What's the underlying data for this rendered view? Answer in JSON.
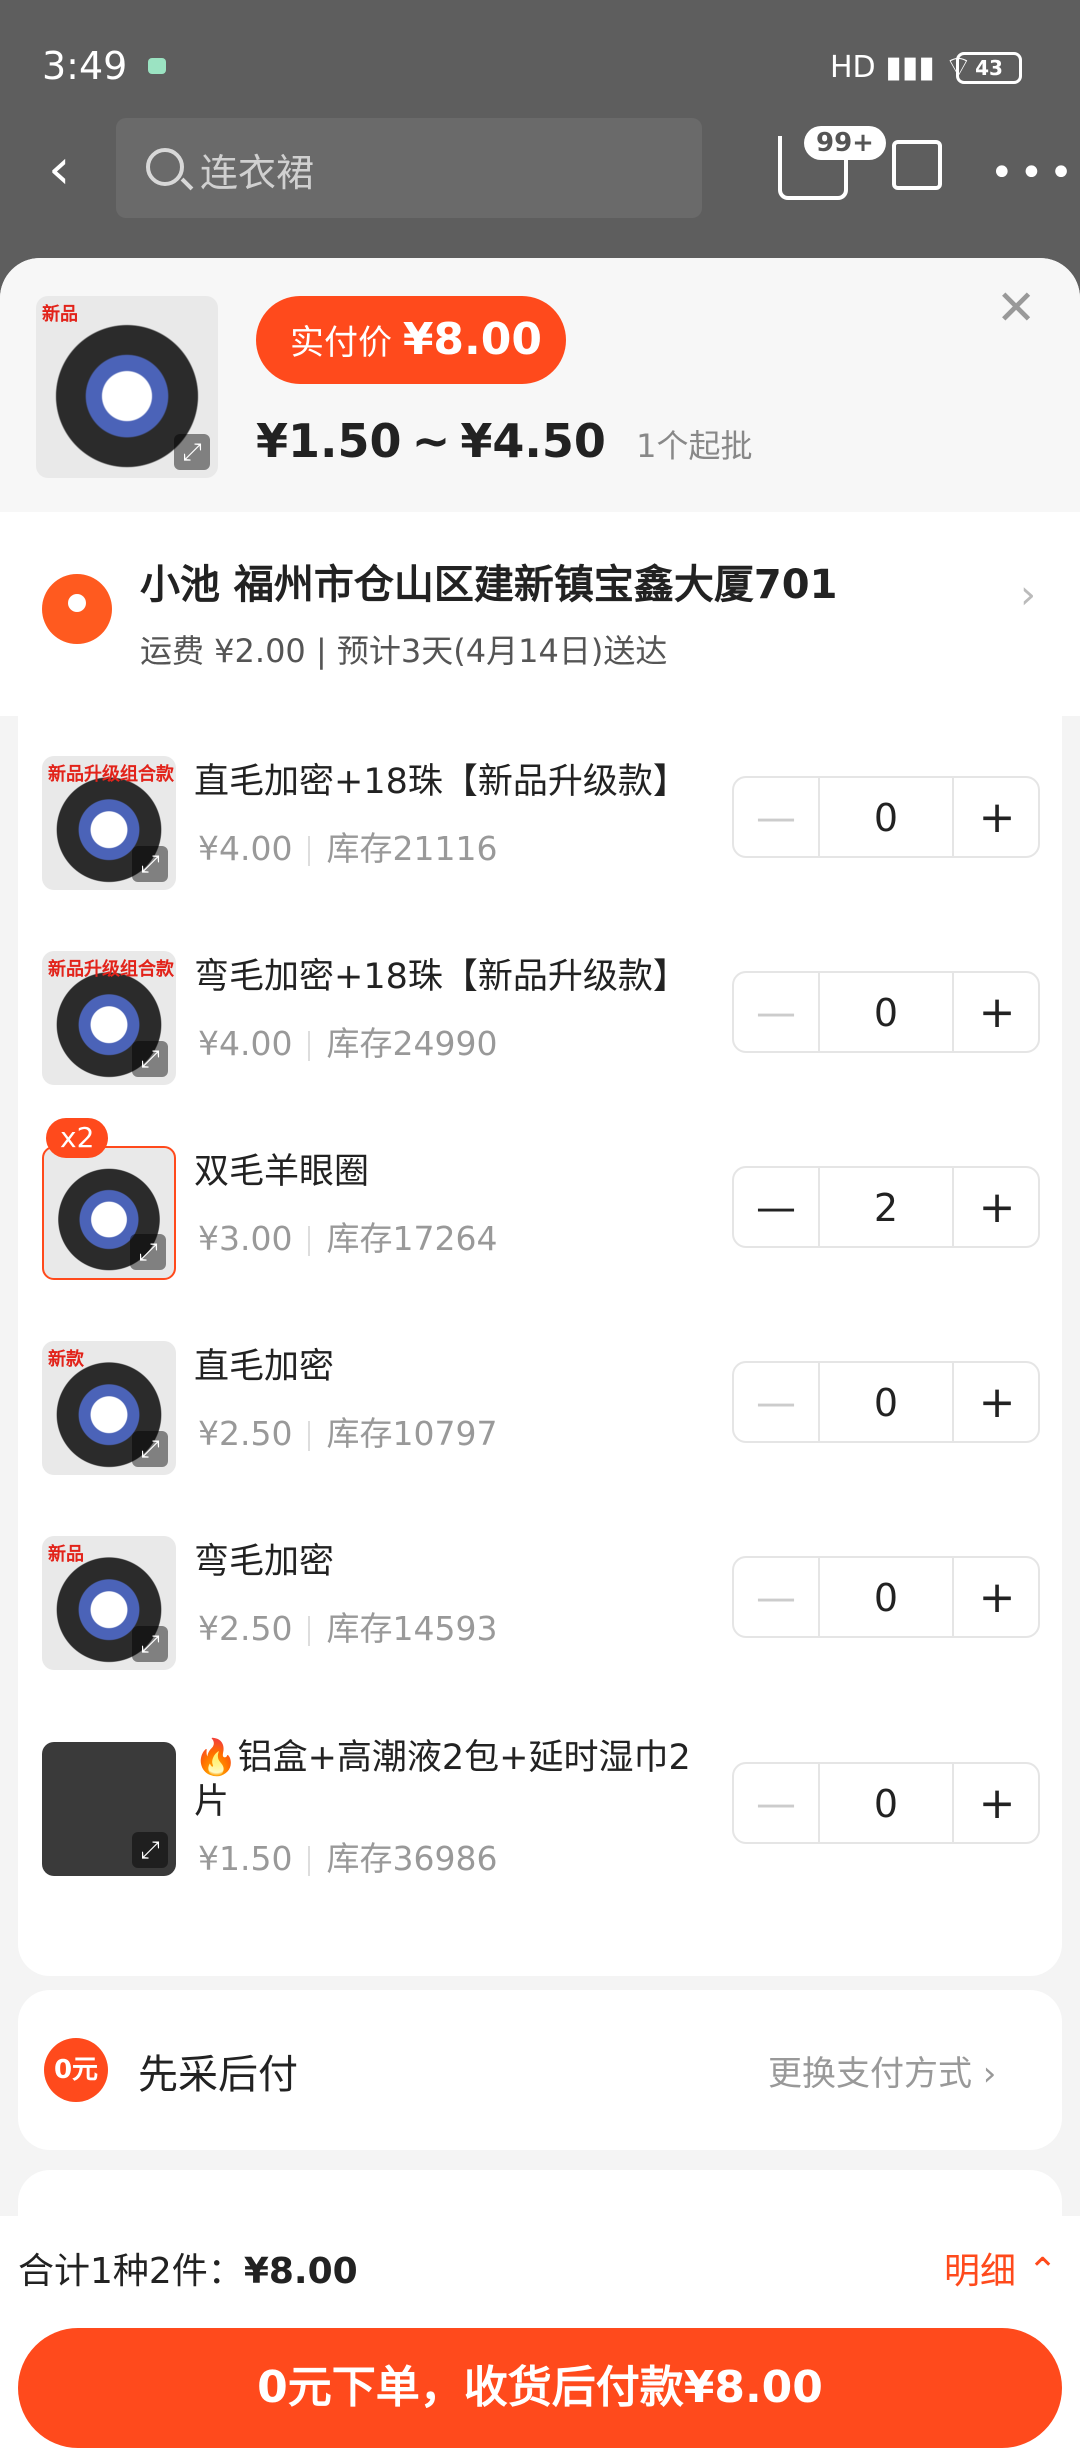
{
  "status": {
    "time": "3:49",
    "signal": "HD ▮▮▮ ⌔",
    "battery": "43"
  },
  "nav": {
    "search_placeholder": "连衣裙",
    "cart_badge": "99+"
  },
  "header": {
    "thumb_tag": "新品",
    "paid_label": "实付价",
    "paid_price": "¥8.00",
    "range_low": "¥1.50",
    "range_sep": "~",
    "range_high": "¥4.50",
    "min_order": "1个起批"
  },
  "address": {
    "name_line": "小池 福州市仓山区建新镇宝鑫大厦701",
    "fee_line": "运费 ¥2.00 | 预计3天(4月14日)送达"
  },
  "items": [
    {
      "tag": "新品升级组合款",
      "title": "直毛加密+18珠【新品升级款】",
      "price": "¥4.00",
      "stock": "库存21116",
      "qty": "0"
    },
    {
      "tag": "新品升级组合款",
      "title": "弯毛加密+18珠【新品升级款】",
      "price": "¥4.00",
      "stock": "库存24990",
      "qty": "0"
    },
    {
      "tag": "",
      "badge": "x2",
      "title": "双毛羊眼圈",
      "price": "¥3.00",
      "stock": "库存17264",
      "qty": "2"
    },
    {
      "tag": "新款",
      "title": "直毛加密",
      "price": "¥2.50",
      "stock": "库存10797",
      "qty": "0"
    },
    {
      "tag": "新品",
      "title": "弯毛加密",
      "price": "¥2.50",
      "stock": "库存14593",
      "qty": "0"
    },
    {
      "tag": "",
      "title": "🔥铝盒+高潮液2包+延时湿巾2片",
      "price": "¥1.50",
      "stock": "库存36986",
      "qty": "0"
    }
  ],
  "payment": {
    "label": "先采后付",
    "change": "更换支付方式 ›",
    "icon_text": "0元"
  },
  "footer": {
    "total_label": "合计1种2件：",
    "total_value": "¥8.00",
    "detail": "明细 ⌃",
    "order_button": "0元下单，收货后付款¥8.00"
  },
  "icons": {
    "back": "chevron-left-icon",
    "search": "search-icon",
    "cart": "cart-icon",
    "share": "share-icon",
    "more": "more-icon",
    "close": "close-icon",
    "location": "location-pin-icon",
    "expand": "expand-icon"
  },
  "colors": {
    "accent": "#ff4a1c",
    "sheet_bg": "#f4f4f4",
    "dim_bg": "#5e5e5e"
  }
}
